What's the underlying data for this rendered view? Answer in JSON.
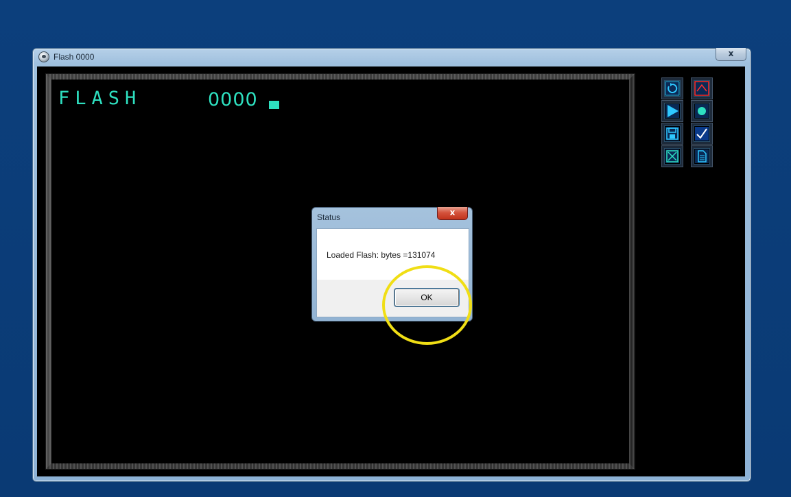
{
  "main_window": {
    "title": "Flash 0000",
    "close_label": "x",
    "display": {
      "flash_label": "FLASH",
      "counter": "0000"
    },
    "toolbar": [
      {
        "icon": "refresh-icon",
        "color": "#2ec8ff"
      },
      {
        "icon": "chart-icon",
        "color": "#ff3030"
      },
      {
        "icon": "play-icon",
        "color": "#2ec8ff"
      },
      {
        "icon": "record-icon",
        "color": "#2ee0c0"
      },
      {
        "icon": "save-icon",
        "color": "#2ec8ff"
      },
      {
        "icon": "check-icon",
        "color": "#ffffff"
      },
      {
        "icon": "close-box-icon",
        "color": "#2ee0c0"
      },
      {
        "icon": "document-icon",
        "color": "#2ec8ff"
      }
    ]
  },
  "dialog": {
    "title": "Status",
    "close_label": "x",
    "message": "Loaded Flash: bytes =131074",
    "ok_label": "OK"
  },
  "colors": {
    "desktop": "#0b3d78",
    "display_text": "#2ee0c0",
    "highlight": "#f0de15"
  }
}
